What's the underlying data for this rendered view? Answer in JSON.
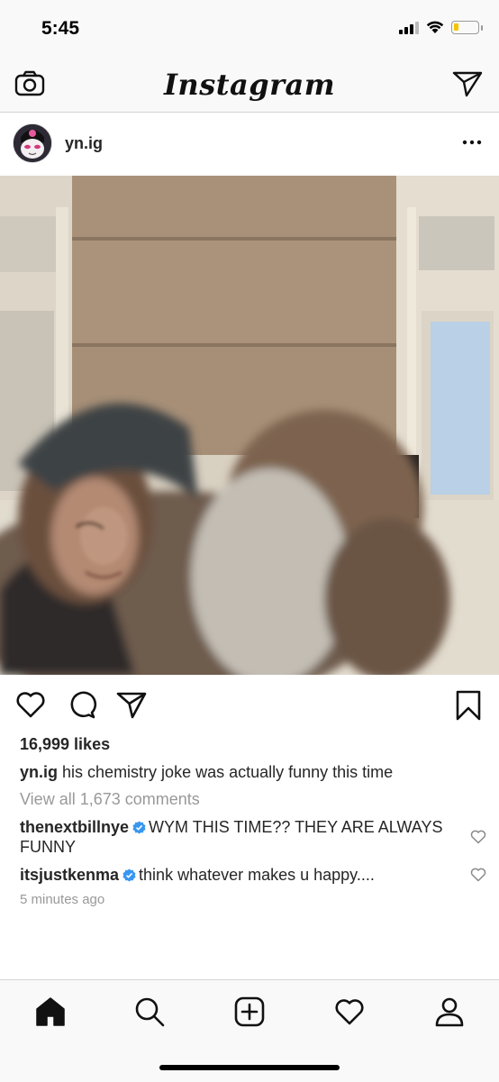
{
  "status_bar": {
    "time": "5:45"
  },
  "top_bar": {
    "logo": "Instagram",
    "left_icon": "camera-icon",
    "right_icon": "direct-message-icon"
  },
  "post": {
    "username": "yn.ig",
    "likes": "16,999 likes",
    "caption": {
      "username": "yn.ig",
      "text": "his chemistry joke was actually funny this time"
    },
    "view_all_comments": "View all 1,673 comments",
    "comments": [
      {
        "username": "thenextbillnye",
        "verified": true,
        "text": "WYM THIS TIME?? THEY ARE ALWAYS FUNNY"
      },
      {
        "username": "itsjustkenma",
        "verified": true,
        "text": "think whatever makes u happy...."
      }
    ],
    "time_ago": "5 minutes ago",
    "actions": [
      "heart-icon",
      "comment-icon",
      "share-icon",
      "bookmark-icon"
    ]
  },
  "tab_bar": {
    "items": [
      "home-icon",
      "search-icon",
      "add-post-icon",
      "activity-heart-icon",
      "profile-icon"
    ]
  },
  "colors": {
    "verified": "#3897f0",
    "battery": "#f5c400",
    "secondary_text": "#999999"
  }
}
